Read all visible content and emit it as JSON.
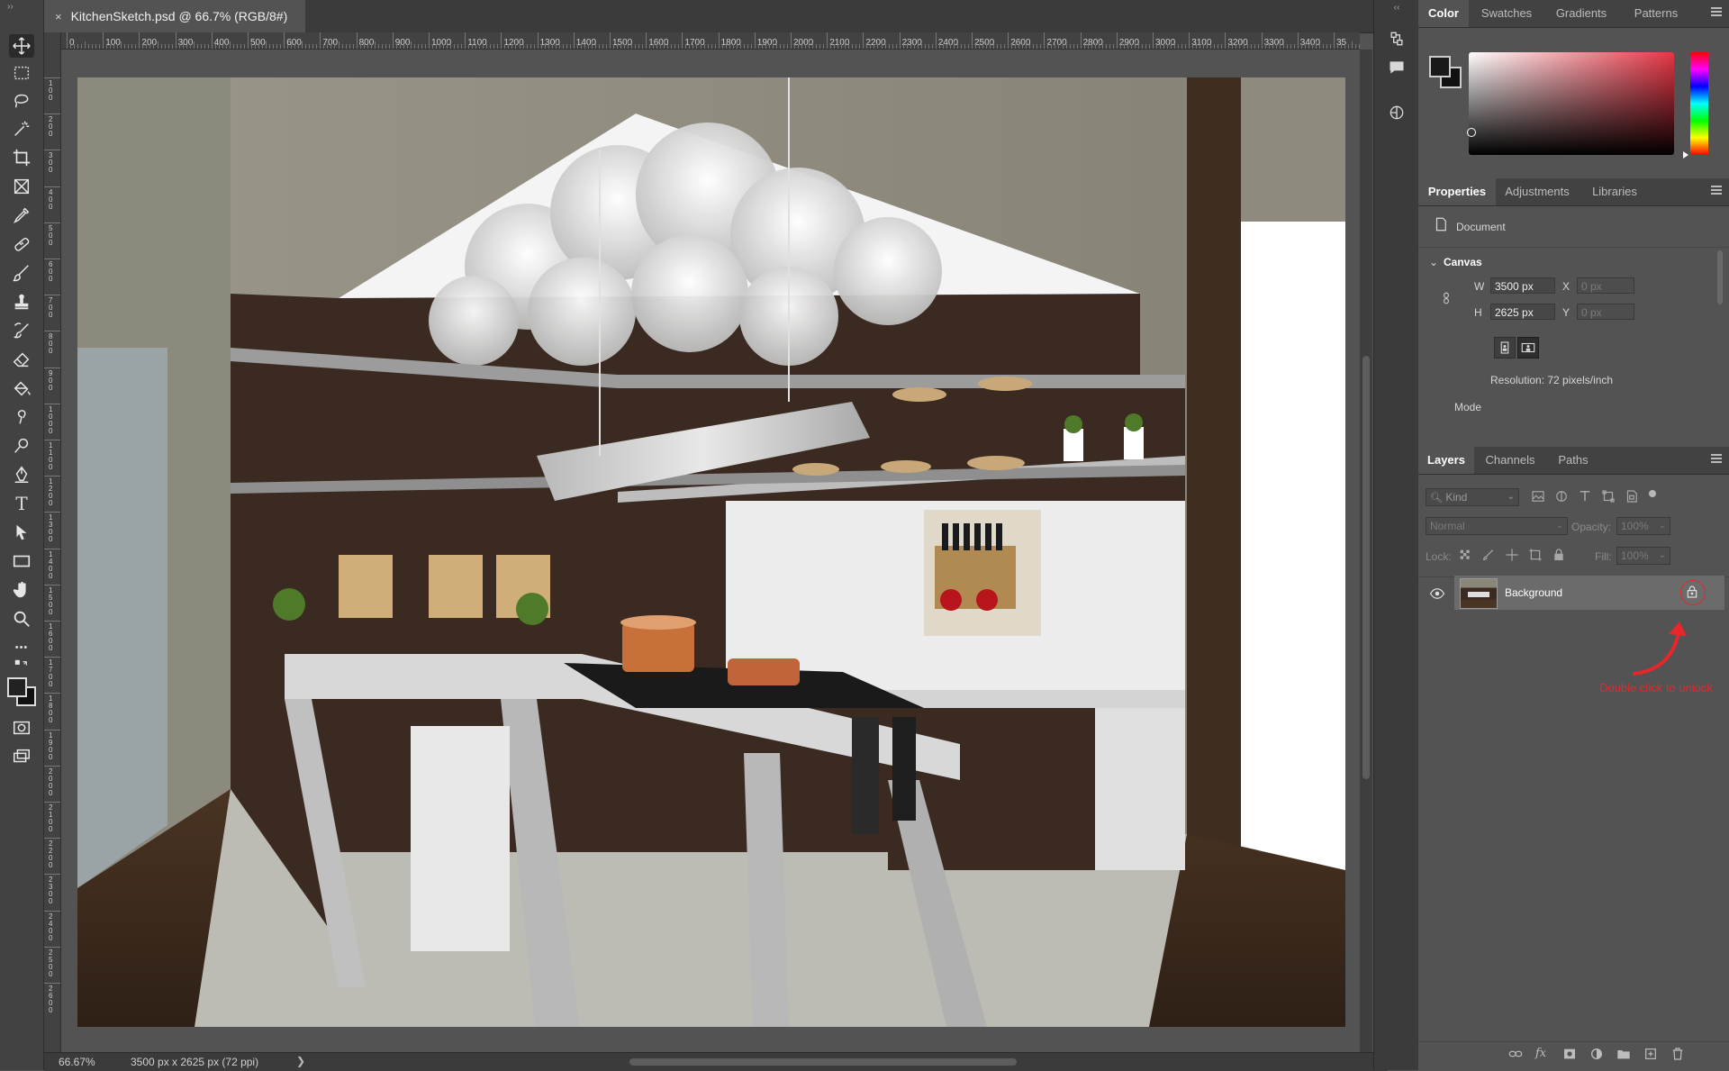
{
  "document": {
    "tab_title": "KitchenSketch.psd @ 66.7% (RGB/8#)",
    "close_glyph": "×",
    "zoom": "66.67%",
    "dimensions": "3500 px x 2625 px (72 ppi)",
    "status_arrow": "❯"
  },
  "ruler": {
    "h_labels": [
      "0",
      "100",
      "200",
      "300",
      "400",
      "500",
      "600",
      "700",
      "800",
      "900",
      "1000",
      "1100",
      "1200",
      "1300",
      "1400",
      "1500",
      "1600",
      "1700",
      "1800",
      "1900",
      "2000",
      "2100",
      "2200",
      "2300",
      "2400",
      "2500",
      "2600",
      "2700",
      "2800",
      "2900",
      "3000",
      "3100",
      "3200",
      "3300",
      "3400",
      "35"
    ],
    "v_labels": [
      "100",
      "200",
      "300",
      "400",
      "500",
      "600",
      "700",
      "800",
      "900",
      "1000",
      "1100",
      "1200",
      "1300",
      "1400",
      "1500",
      "1600",
      "1700",
      "1800",
      "1900",
      "2000",
      "2100",
      "2200",
      "2300",
      "2400",
      "2500",
      "2600"
    ]
  },
  "toolbar": {
    "collapse_glyph": "››",
    "tools": [
      "move-tool",
      "marquee-tool",
      "lasso-tool",
      "magic-wand-tool",
      "crop-tool",
      "frame-tool",
      "eyedropper-tool",
      "healing-brush-tool",
      "brush-tool",
      "clone-stamp-tool",
      "history-brush-tool",
      "eraser-tool",
      "paint-bucket-tool",
      "smudge-tool",
      "dodge-tool",
      "pen-tool",
      "type-tool",
      "path-selection-tool",
      "rectangle-tool",
      "hand-tool",
      "zoom-tool",
      "more-tools",
      "swap-colors",
      "foreground-background-colors",
      "quick-mask-mode",
      "screen-mode"
    ],
    "type_glyph": "T",
    "more_glyph": "•••"
  },
  "color_panel": {
    "tabs": [
      "Color",
      "Swatches",
      "Gradients",
      "Patterns"
    ],
    "hue_colors": [
      "#ff0000",
      "#ff00ff",
      "#0000ff",
      "#00ffff",
      "#00ff00",
      "#ffff00",
      "#ff0000"
    ],
    "picker_base": "#e53645"
  },
  "properties_panel": {
    "tabs": [
      "Properties",
      "Adjustments",
      "Libraries"
    ],
    "document_label": "Document",
    "canvas_header": "Canvas",
    "w_label": "W",
    "w_value": "3500 px",
    "h_label": "H",
    "h_value": "2625 px",
    "x_label": "X",
    "x_placeholder": "0 px",
    "y_label": "Y",
    "y_placeholder": "0 px",
    "resolution": "Resolution: 72 pixels/inch",
    "mode_label": "Mode"
  },
  "layers_panel": {
    "tabs": [
      "Layers",
      "Channels",
      "Paths"
    ],
    "filter_kind": "Kind",
    "blend_mode": "Normal",
    "opacity_label": "Opacity:",
    "opacity_value": "100%",
    "lock_label": "Lock:",
    "fill_label": "Fill:",
    "fill_value": "100%",
    "layers": [
      {
        "name": "Background",
        "visible": true,
        "locked": true
      }
    ],
    "annotation": "Double click to unlock",
    "annotation_color": "#e8262b"
  },
  "colors": {
    "accent_red": "#e8262b",
    "panel_bg": "#535353",
    "dark_bg": "#3b3b3b"
  }
}
